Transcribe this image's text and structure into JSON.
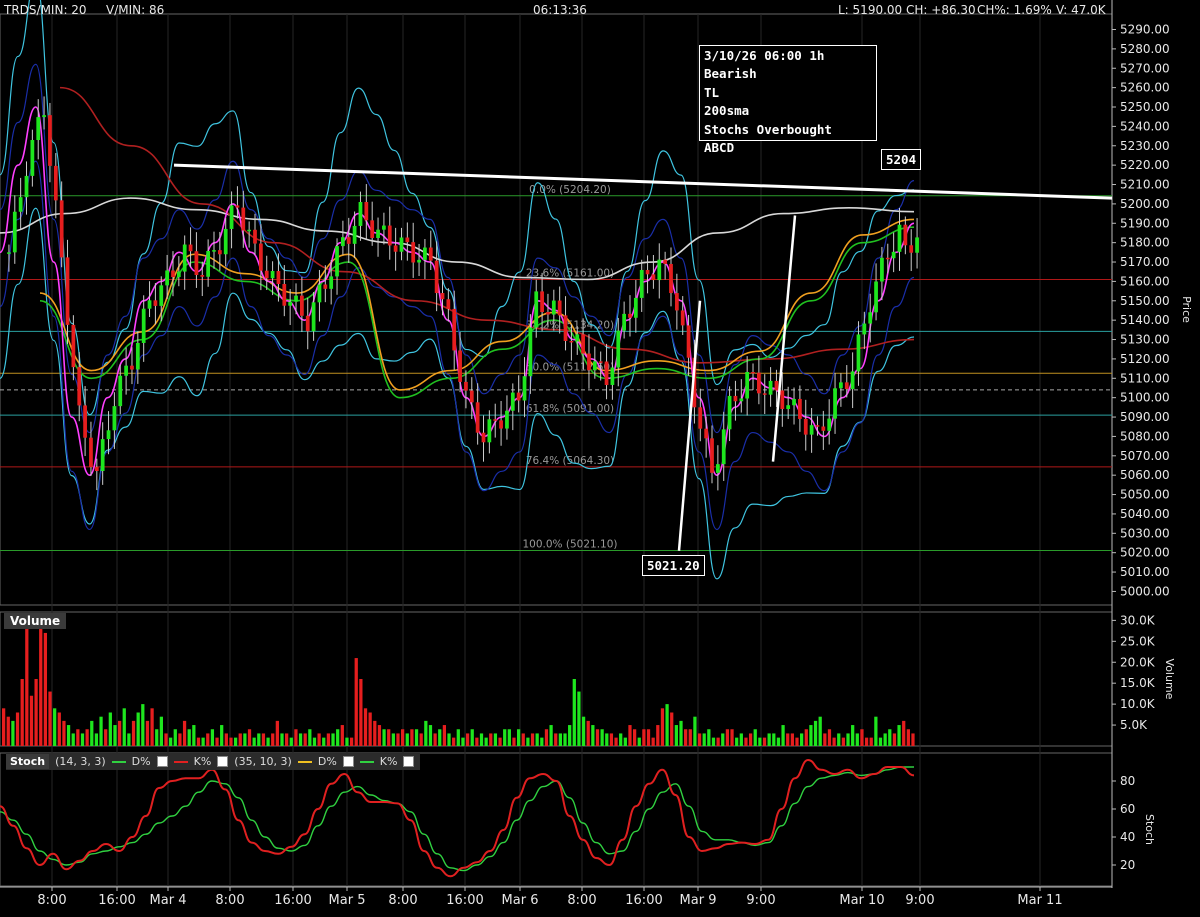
{
  "header": {
    "trds_min": "TRDS/MIN: 20",
    "v_min": "V/MIN: 86",
    "clock": "06:13:36",
    "last": "L: 5190.00",
    "change": "CH: +86.30",
    "change_pct": "CH%: 1.69%",
    "volume": "V: 47.0K"
  },
  "annotation": {
    "lines": [
      "3/10/26 06:00 1h Bearish",
      "TL",
      "200sma",
      "Stochs Overbought",
      "ABCD"
    ]
  },
  "tags": {
    "high": "5204",
    "low": "5021.20"
  },
  "colors": {
    "background": "#000000",
    "up_candle": "#1ee61e",
    "down_candle": "#e61e1e",
    "bollinger": "#3fc4e0",
    "keltner": "#1a2ea8",
    "sma200": "#d8d8d8",
    "ema_orange": "#f0a020",
    "ema_magenta": "#ff40ff",
    "stoch_k": "#e02020",
    "stoch_d": "#30d040"
  },
  "chart_data": [
    {
      "type": "candlestick",
      "ylabel": "Price",
      "ylim": [
        4993,
        5298
      ],
      "y_ticks": [
        "5290.00",
        "5280.00",
        "5270.00",
        "5260.00",
        "5250.00",
        "5240.00",
        "5230.00",
        "5220.00",
        "5210.00",
        "5200.00",
        "5190.00",
        "5180.00",
        "5170.00",
        "5160.00",
        "5150.00",
        "5140.00",
        "5130.00",
        "5120.00",
        "5110.00",
        "5100.00",
        "5090.00",
        "5080.00",
        "5070.00",
        "5060.00",
        "5050.00",
        "5040.00",
        "5030.00",
        "5020.00",
        "5010.00",
        "5000.00"
      ],
      "x_labels": [
        "8:00",
        "16:00",
        "Mar 4",
        "8:00",
        "16:00",
        "Mar 5",
        "8:00",
        "16:00",
        "Mar 6",
        "8:00",
        "16:00",
        "Mar 9",
        "9:00",
        "Mar 10",
        "9:00",
        "Mar 11"
      ],
      "close_path": [
        5175,
        5220,
        5250,
        5170,
        5090,
        5060,
        5100,
        5120,
        5150,
        5160,
        5175,
        5165,
        5180,
        5200,
        5175,
        5160,
        5150,
        5140,
        5160,
        5180,
        5195,
        5185,
        5180,
        5175,
        5170,
        5140,
        5100,
        5080,
        5090,
        5100,
        5150,
        5145,
        5130,
        5120,
        5110,
        5140,
        5160,
        5170,
        5150,
        5100,
        5060,
        5095,
        5110,
        5105,
        5100,
        5090,
        5080,
        5100,
        5115,
        5150,
        5175,
        5190
      ],
      "fibonacci": [
        {
          "label": "0.0% (5204.20)",
          "value": 5204.2
        },
        {
          "label": "23.6% (5161.00)",
          "value": 5161.0
        },
        {
          "label": "38.2% (5134.20)",
          "value": 5134.2
        },
        {
          "label": "50.0% (5112.60)",
          "value": 5112.6
        },
        {
          "label": "61.8% (5091.00)",
          "value": 5091.0
        },
        {
          "label": "76.4% (5064.30)",
          "value": 5064.3
        },
        {
          "label": "100.0% (5021.10)",
          "value": 5021.1
        }
      ],
      "trendline": {
        "from": 5220,
        "to": 5203
      },
      "sma200": [
        5185,
        5195,
        5203,
        5197,
        5192,
        5186,
        5180,
        5170,
        5162,
        5161,
        5170,
        5185,
        5195,
        5198,
        5196
      ],
      "ema_slow": [
        5260,
        5230,
        5200,
        5180,
        5165,
        5150,
        5140,
        5135,
        5125,
        5118,
        5120,
        5125,
        5130
      ],
      "ema_fast": [
        5150,
        5110,
        5130,
        5170,
        5160,
        5150,
        5170,
        5100,
        5110,
        5125,
        5140,
        5110,
        5115,
        5110,
        5120,
        5150,
        5180,
        5188
      ],
      "abcd": [
        {
          "x": "5021.20",
          "y1": 5021,
          "y2": 5150
        },
        {
          "x": "",
          "y1": 5067,
          "y2": 5194
        }
      ]
    },
    {
      "type": "bar",
      "title": "Volume",
      "ylabel": "Volume",
      "ylim": [
        0,
        32000
      ],
      "y_ticks": [
        "30.0K",
        "25.0K",
        "20.0K",
        "15.0K",
        "10.0K",
        "5.0K"
      ],
      "values": [
        9,
        7,
        6,
        8,
        16,
        31,
        12,
        16,
        29,
        27,
        13,
        9,
        8,
        6,
        5,
        3,
        4,
        3,
        4,
        6,
        3,
        7,
        4,
        8,
        5,
        6,
        9,
        3,
        6,
        8,
        10,
        6,
        9,
        4,
        7,
        3,
        2,
        4,
        3,
        6,
        4,
        5,
        2,
        2,
        3,
        4,
        2,
        5,
        3,
        2,
        2,
        3,
        3,
        4,
        2,
        3,
        3,
        2,
        3,
        6,
        3,
        3,
        2,
        4,
        3,
        3,
        4,
        2,
        3,
        2,
        3,
        3,
        4,
        5,
        2,
        2,
        21,
        16,
        9,
        8,
        6,
        5,
        4,
        4,
        3,
        3,
        4,
        3,
        4,
        4,
        3,
        6,
        5,
        3,
        4,
        5,
        3,
        2,
        4,
        2,
        3,
        4,
        2,
        3,
        2,
        3,
        3,
        2,
        4,
        4,
        2,
        4,
        3,
        2,
        3,
        3,
        2,
        4,
        5,
        3,
        3,
        3,
        5,
        16,
        13,
        7,
        6,
        5,
        4,
        4,
        3,
        3,
        2,
        3,
        2,
        5,
        4,
        2,
        4,
        4,
        2,
        5,
        9,
        10,
        8,
        5,
        6,
        4,
        4,
        7,
        3,
        3,
        4,
        2,
        2,
        3,
        4,
        4,
        2,
        3,
        2,
        3,
        4,
        2,
        2,
        3,
        3,
        2,
        5,
        3,
        3,
        2,
        3,
        4,
        5,
        6,
        7,
        3,
        4,
        2,
        3,
        2,
        3,
        5,
        3,
        4,
        2,
        2,
        7,
        2,
        3,
        4,
        3,
        5,
        6,
        4,
        3
      ],
      "up": [
        0,
        0,
        1,
        0,
        0,
        0,
        0,
        0,
        0,
        0,
        0,
        1,
        0,
        0,
        1,
        1,
        0,
        1,
        0,
        1,
        1,
        1,
        0,
        1,
        1,
        0,
        1,
        1,
        0,
        1,
        1,
        0,
        0,
        1,
        1,
        0,
        1,
        1,
        0,
        0,
        1,
        1,
        0,
        1,
        0,
        1,
        0,
        1,
        0,
        0,
        1,
        0,
        1,
        0,
        1,
        1,
        0,
        1,
        0,
        0,
        1,
        0,
        1,
        0,
        1,
        0,
        1,
        1,
        0,
        1,
        0,
        1,
        1,
        0,
        1,
        0,
        0,
        0,
        0,
        0,
        0,
        0,
        1,
        0,
        1,
        0,
        0,
        1,
        0,
        1,
        0,
        1,
        1,
        0,
        1,
        0,
        1,
        0,
        1,
        1,
        0,
        1,
        0,
        1,
        1,
        0,
        1,
        0,
        1,
        1,
        0,
        1,
        0,
        1,
        0,
        1,
        1,
        0,
        1,
        0,
        1,
        1,
        1,
        1,
        1,
        1,
        0,
        1,
        0,
        1,
        1,
        0,
        0,
        1,
        1,
        0,
        0,
        1,
        0,
        0,
        0,
        0,
        0,
        1,
        0,
        1,
        1,
        0,
        0,
        1,
        0,
        1,
        1,
        1,
        0,
        1,
        0,
        0,
        1,
        1,
        0,
        0,
        1,
        1,
        0,
        1,
        1,
        1,
        1,
        0,
        0,
        0,
        1,
        0,
        1,
        1,
        1,
        0,
        0,
        0,
        1,
        0,
        1,
        1,
        1,
        0,
        0,
        0,
        1,
        1,
        1,
        1,
        0,
        1,
        0,
        0,
        0,
        0,
        0
      ]
    },
    {
      "type": "line",
      "title": "Stoch",
      "ylabel": "Stoch",
      "ylim": [
        5,
        100
      ],
      "y_ticks": [
        "80",
        "60",
        "40",
        "20"
      ],
      "params_1": "(14, 3, 3)",
      "params_2": "(35, 10, 3)",
      "legend": [
        "D%",
        "K%",
        "D%",
        "K%"
      ],
      "series": [
        {
          "values": [
            62,
            48,
            32,
            20,
            28,
            17,
            23,
            30,
            35,
            30,
            40,
            55,
            75,
            80,
            82,
            82,
            88,
            74,
            52,
            36,
            30,
            28,
            33,
            42,
            60,
            78,
            85,
            72,
            65,
            65,
            64,
            52,
            30,
            18,
            12,
            18,
            22,
            30,
            45,
            68,
            82,
            85,
            80,
            55,
            38,
            25,
            20,
            38,
            62,
            78,
            88,
            70,
            40,
            30,
            32,
            35,
            36,
            35,
            38,
            60,
            82,
            95,
            88,
            85,
            88,
            82,
            85,
            90,
            90,
            84
          ]
        },
        {
          "values": [
            58,
            52,
            42,
            30,
            24,
            20,
            22,
            28,
            30,
            33,
            36,
            42,
            50,
            55,
            62,
            72,
            80,
            78,
            68,
            52,
            40,
            32,
            30,
            34,
            48,
            62,
            72,
            76,
            70,
            66,
            64,
            58,
            42,
            28,
            18,
            16,
            20,
            26,
            36,
            52,
            66,
            76,
            80,
            68,
            50,
            36,
            28,
            30,
            44,
            60,
            72,
            78,
            62,
            44,
            38,
            38,
            36,
            34,
            36,
            48,
            64,
            76,
            82,
            84,
            86,
            84,
            85,
            88,
            90,
            90
          ]
        }
      ]
    }
  ]
}
